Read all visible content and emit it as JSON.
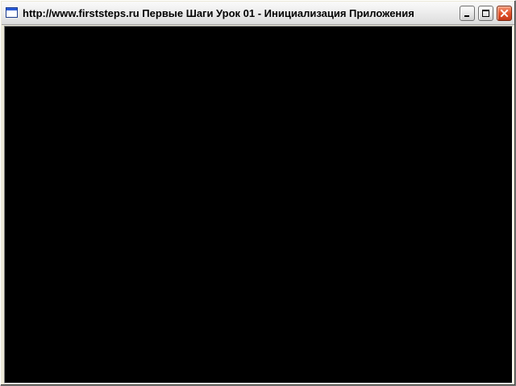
{
  "window": {
    "title": "http://www.firststeps.ru Первые Шаги Урок 01 - Инициализация Приложения",
    "icon": "application-window-icon",
    "controls": {
      "minimize_icon": "minimize-icon",
      "maximize_icon": "maximize-icon",
      "close_icon": "close-icon"
    }
  },
  "viewport": {
    "background_color": "#000000"
  }
}
